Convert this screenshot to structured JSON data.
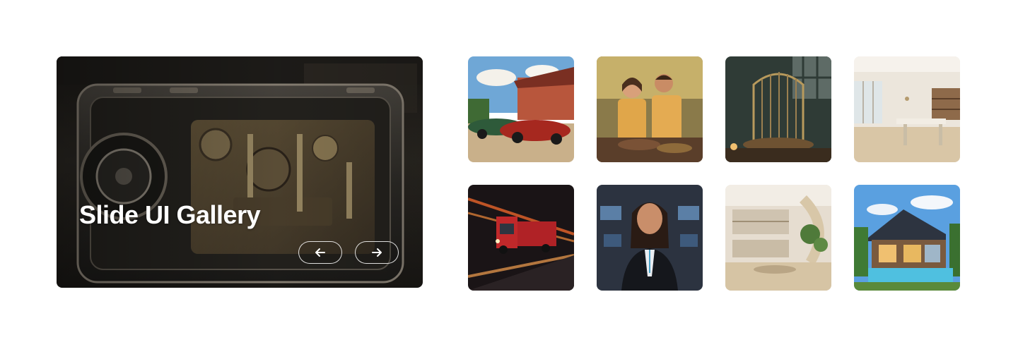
{
  "hero": {
    "title": "Slide UI Gallery",
    "image_icon": "mechanical-clock-machine-image",
    "prev_icon": "arrow-left-icon",
    "next_icon": "arrow-right-icon"
  },
  "thumbnails": [
    {
      "subject": "vintage-cars-image"
    },
    {
      "subject": "couple-cooking-image"
    },
    {
      "subject": "birdcage-room-image"
    },
    {
      "subject": "office-interior-image"
    },
    {
      "subject": "truck-highway-image"
    },
    {
      "subject": "businesswoman-office-image"
    },
    {
      "subject": "modern-interior-image"
    },
    {
      "subject": "modern-house-pool-image"
    }
  ],
  "colors": {
    "background": "#ffffff",
    "hero_text": "#ffffff",
    "button_border": "#ffffff"
  }
}
